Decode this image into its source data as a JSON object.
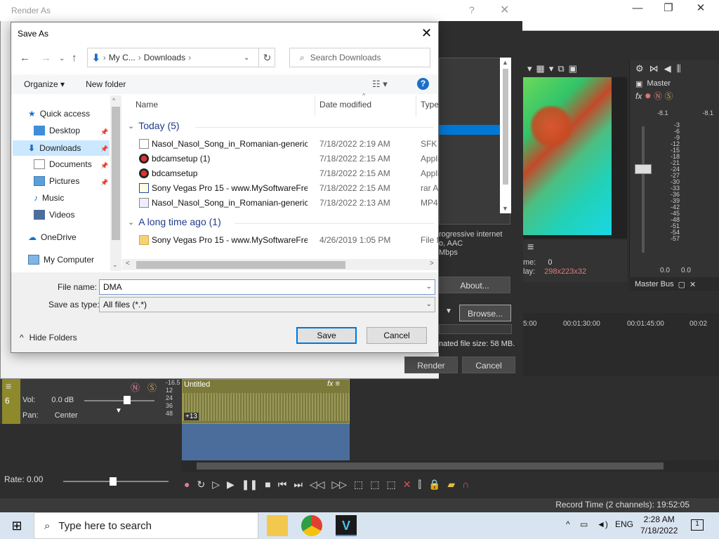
{
  "render_dialog": {
    "title": "Render As",
    "help": "?",
    "close": "✕",
    "description": [
      "rogressive internet",
      "o, AAC",
      "Mbps"
    ],
    "about": "About...",
    "browse": "Browse...",
    "estimated": "nated file size: 58 MB.",
    "render": "Render",
    "cancel": "Cancel"
  },
  "save_as": {
    "title": "Save As",
    "breadcrumb": [
      "My C...",
      "Downloads"
    ],
    "search_placeholder": "Search Downloads",
    "toolbar": {
      "organize": "Organize",
      "new_folder": "New folder"
    },
    "help": "?",
    "tree": [
      {
        "label": "Quick access",
        "icon": "star-icon"
      },
      {
        "label": "Desktop",
        "icon": "desktop-icon",
        "pinned": true
      },
      {
        "label": "Downloads",
        "icon": "download-icon",
        "pinned": true,
        "selected": true
      },
      {
        "label": "Documents",
        "icon": "documents-icon",
        "pinned": true
      },
      {
        "label": "Pictures",
        "icon": "pictures-icon",
        "pinned": true
      },
      {
        "label": "Music",
        "icon": "music-icon"
      },
      {
        "label": "Videos",
        "icon": "videos-icon"
      },
      {
        "label": "OneDrive",
        "icon": "cloud-icon"
      },
      {
        "label": "My Computer",
        "icon": "computer-icon"
      }
    ],
    "columns": {
      "name": "Name",
      "date": "Date modified",
      "type": "Type"
    },
    "groups": [
      {
        "label": "Today (5)",
        "files": [
          {
            "name": "Nasol_Nasol_Song_in_Romanian-generic...",
            "date": "7/18/2022 2:19 AM",
            "type": "SFK F",
            "icon": "file-icon"
          },
          {
            "name": "bdcamsetup (1)",
            "date": "7/18/2022 2:15 AM",
            "type": "Appli",
            "icon": "app-icon"
          },
          {
            "name": "bdcamsetup",
            "date": "7/18/2022 2:15 AM",
            "type": "Appli",
            "icon": "app-icon"
          },
          {
            "name": "Sony Vegas Pro 15 - www.MySoftwareFre...",
            "date": "7/18/2022 2:15 AM",
            "type": "rar A",
            "icon": "rar-icon"
          },
          {
            "name": "Nasol_Nasol_Song_in_Romanian-generic...",
            "date": "7/18/2022 2:13 AM",
            "type": "MP4",
            "icon": "video-file-icon"
          }
        ]
      },
      {
        "label": "A long time ago (1)",
        "files": [
          {
            "name": "Sony Vegas Pro 15 - www.MySoftwareFre...",
            "date": "4/26/2019 1:05 PM",
            "type": "File f",
            "icon": "folder-icon"
          }
        ]
      }
    ],
    "file_name_label": "File name:",
    "file_name_value": "DMA",
    "save_type_label": "Save as type:",
    "save_type_value": "All files (*.*)",
    "hide_folders": "Hide Folders",
    "save": "Save",
    "cancel": "Cancel"
  },
  "vegas": {
    "master_label": "Master",
    "master_bus": "Master Bus",
    "peak_left": "-8.1",
    "peak_right": "-8.1",
    "meter_scale": [
      "3",
      "6",
      "9",
      "12",
      "15",
      "18",
      "21",
      "24",
      "27",
      "30",
      "33",
      "36",
      "39",
      "42",
      "45",
      "48",
      "51",
      "54",
      "57"
    ],
    "fader_left": "0.0",
    "fader_right": "0.0",
    "preview_frame": "0",
    "preview_display": "298x223x32",
    "preview_frame_label": "me:",
    "preview_display_label": "lay:",
    "ruler": [
      "5:00",
      "00:01:30:00",
      "00:01:45:00",
      "00:02"
    ],
    "track": {
      "number": "6",
      "vol_label": "Vol:",
      "vol_value": "0.0 dB",
      "pan_label": "Pan:",
      "pan_value": "Center",
      "db_scale": [
        "-16.5",
        "12",
        "24",
        "36",
        "48"
      ],
      "clip_title": "Untitled",
      "clip_gain": "+13"
    },
    "rate": "Rate: 0.00",
    "record_time": "Record Time (2 channels): 19:52:05"
  },
  "taskbar": {
    "search_placeholder": "Type here to search",
    "language": "ENG",
    "time": "2:28 AM",
    "date": "7/18/2022",
    "notifications": "1"
  }
}
